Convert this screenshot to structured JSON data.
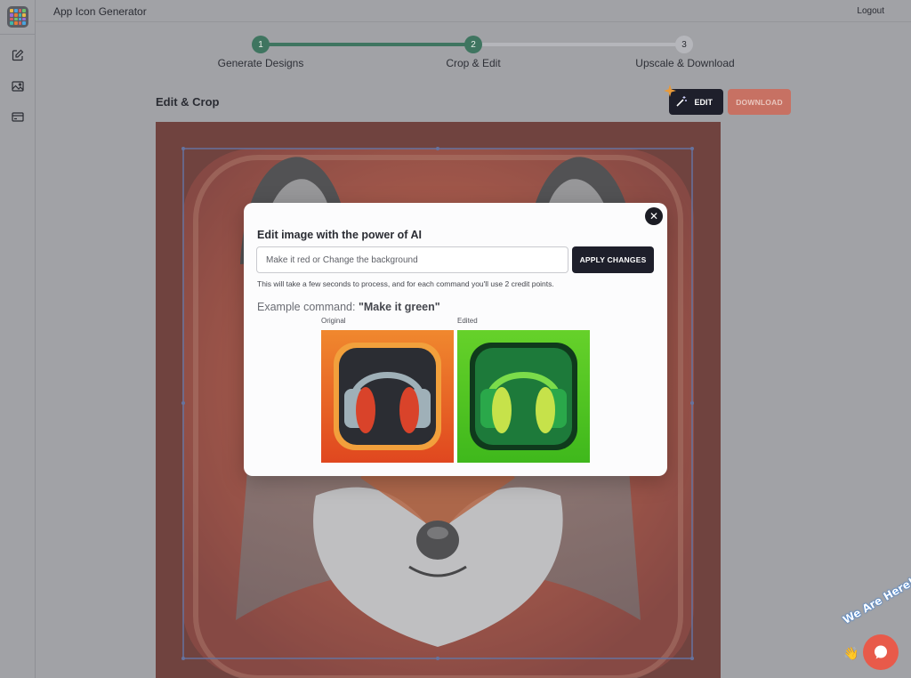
{
  "header": {
    "app_title": "App Icon Generator",
    "logout_label": "Logout"
  },
  "stepper": {
    "steps": [
      {
        "number": "1",
        "label": "Generate Designs",
        "state": "complete"
      },
      {
        "number": "2",
        "label": "Crop & Edit",
        "state": "active"
      },
      {
        "number": "3",
        "label": "Upscale & Download",
        "state": "pending"
      }
    ]
  },
  "editor": {
    "section_title": "Edit & Crop",
    "edit_label": "EDIT",
    "download_label": "DOWNLOAD"
  },
  "modal": {
    "title": "Edit image with the power of AI",
    "input_placeholder": "Make it red or Change the background",
    "input_value": "",
    "apply_label": "APPLY CHANGES",
    "note": "This will take a few seconds to process, and for each command you'll use 2 credit points.",
    "example_prefix": "Example command: ",
    "example_command": "\"Make it green\"",
    "original_label": "Original",
    "edited_label": "Edited"
  },
  "chat": {
    "badge_text": "We Are Here!"
  },
  "icons": {
    "sidebar": [
      "pencil-square-icon",
      "image-icon",
      "credit-card-icon"
    ],
    "edit_button": "magic-wand-icon",
    "modal_close": "close-icon",
    "chat": "chat-bubble-icon"
  },
  "colors": {
    "accent_green": "#3f7560",
    "dark_button": "#1e1f2b",
    "download_button": "#c77163",
    "overlay_bg": "#a1a2a6",
    "chat_bubble": "#e85a4a"
  }
}
